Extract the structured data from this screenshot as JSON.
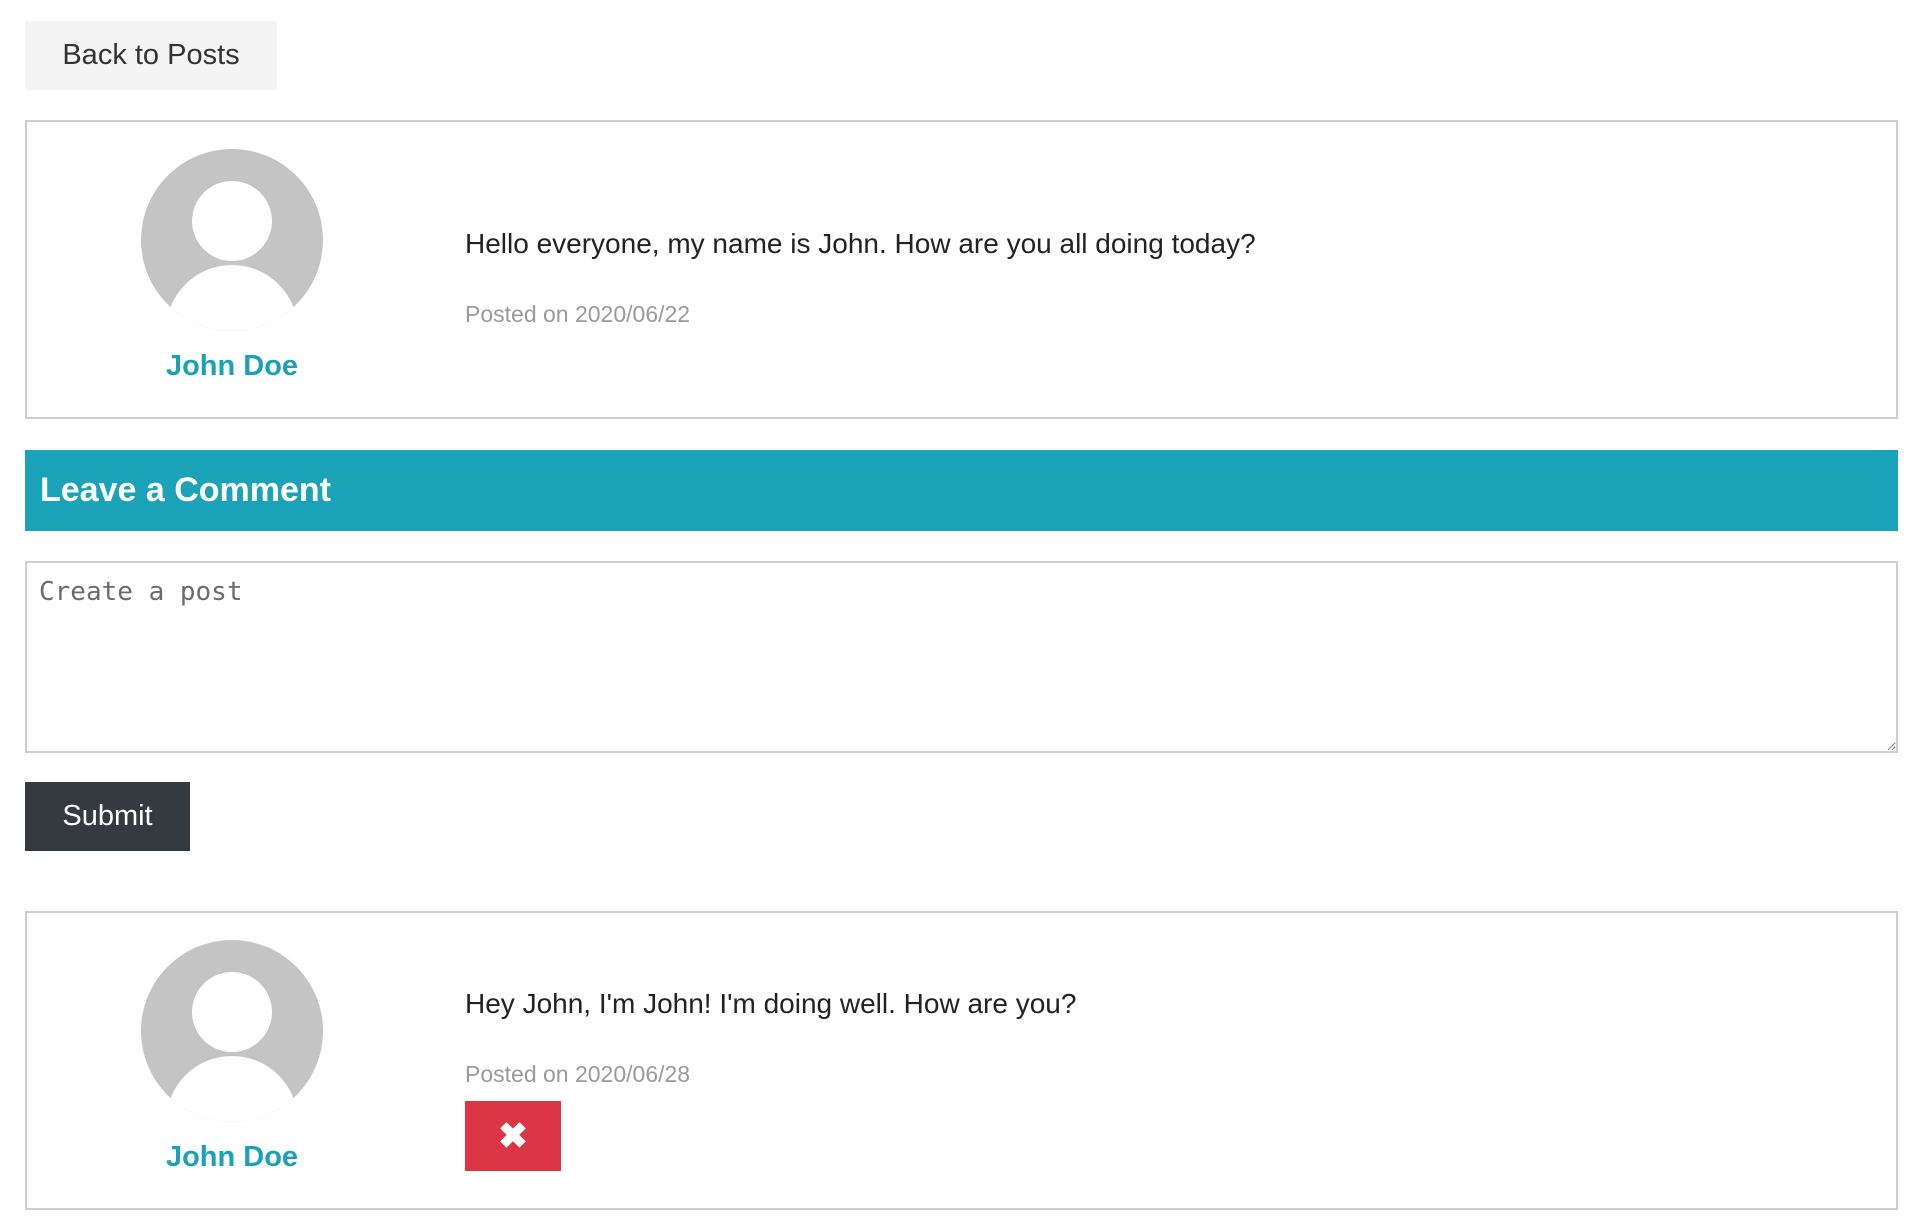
{
  "nav": {
    "back_label": "Back to Posts"
  },
  "post": {
    "author": "John Doe",
    "message": "Hello everyone, my name is John. How are you all doing today?",
    "posted": "Posted on 2020/06/22"
  },
  "comment_form": {
    "header": "Leave a Comment",
    "placeholder": "Create a post",
    "value": "",
    "submit_label": "Submit"
  },
  "comments": [
    {
      "author": "John Doe",
      "message": "Hey John, I'm John! I'm doing well. How are you?",
      "posted": "Posted on 2020/06/28",
      "delete_icon": "✖"
    }
  ],
  "colors": {
    "accent": "#1aa2b8",
    "author_link": "#1ba0b7",
    "danger": "#dc3545",
    "dark_button": "#343a40",
    "avatar_gray": "#c4c4c4"
  }
}
